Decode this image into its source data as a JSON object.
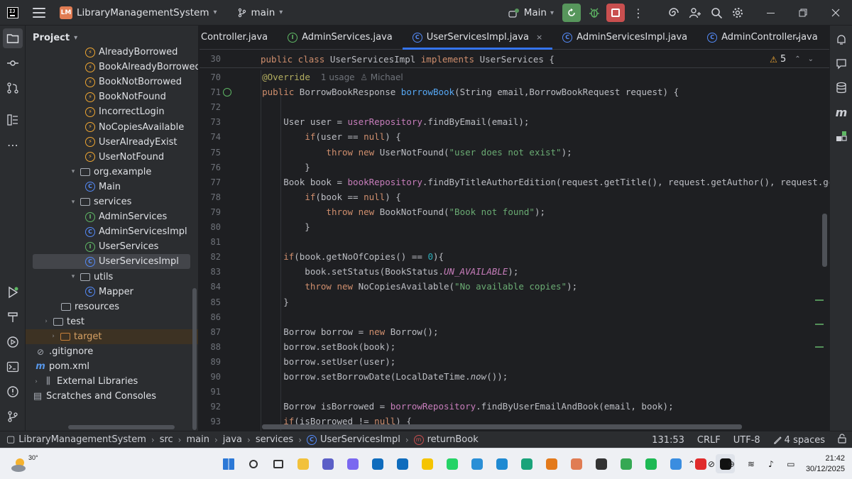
{
  "titlebar": {
    "app_badge": "LM",
    "project_name": "LibraryManagementSystem",
    "branch": "main",
    "run_config": "Main"
  },
  "project_panel": {
    "title": "Project",
    "items": [
      {
        "label": "AlreadyBorrowed",
        "kind": "exception"
      },
      {
        "label": "BookAlreadyBorrowed",
        "kind": "exception"
      },
      {
        "label": "BookNotBorrowed",
        "kind": "exception"
      },
      {
        "label": "BookNotFound",
        "kind": "exception"
      },
      {
        "label": "IncorrectLogin",
        "kind": "exception"
      },
      {
        "label": "NoCopiesAvailable",
        "kind": "exception"
      },
      {
        "label": "UserAlreadyExist",
        "kind": "exception"
      },
      {
        "label": "UserNotFound",
        "kind": "exception"
      },
      {
        "label": "org.example",
        "kind": "package"
      },
      {
        "label": "Main",
        "kind": "class-main"
      },
      {
        "label": "services",
        "kind": "package"
      },
      {
        "label": "AdminServices",
        "kind": "interface"
      },
      {
        "label": "AdminServicesImpl",
        "kind": "class"
      },
      {
        "label": "UserServices",
        "kind": "interface"
      },
      {
        "label": "UserServicesImpl",
        "kind": "class"
      },
      {
        "label": "utils",
        "kind": "package"
      },
      {
        "label": "Mapper",
        "kind": "class"
      },
      {
        "label": "resources",
        "kind": "folder"
      },
      {
        "label": "test",
        "kind": "folder"
      },
      {
        "label": "target",
        "kind": "folder-excluded"
      },
      {
        "label": ".gitignore",
        "kind": "file"
      },
      {
        "label": "pom.xml",
        "kind": "maven"
      },
      {
        "label": "External Libraries",
        "kind": "libraries"
      },
      {
        "label": "Scratches and Consoles",
        "kind": "scratches"
      }
    ]
  },
  "editor": {
    "tabs": [
      {
        "label": "Controller.java",
        "kind": "class"
      },
      {
        "label": "AdminServices.java",
        "kind": "interface"
      },
      {
        "label": "UserServicesImpl.java",
        "kind": "class"
      },
      {
        "label": "AdminServicesImpl.java",
        "kind": "class"
      },
      {
        "label": "AdminController.java",
        "kind": "class"
      }
    ],
    "active_tab_index": 2,
    "tab_close": "×",
    "sticky": {
      "line": "30",
      "text": ""
    },
    "warnings": "5",
    "hint_usage": "1 usage",
    "hint_author": "Michael",
    "line_numbers": [
      "70",
      "71",
      "72",
      "73",
      "74",
      "75",
      "76",
      "77",
      "78",
      "79",
      "80",
      "81",
      "82",
      "83",
      "84",
      "85",
      "86",
      "87",
      "88",
      "89",
      "90",
      "91",
      "92",
      "93"
    ],
    "strings": {
      "user_not_exist": "\"user does not exist\"",
      "book_not_found": "\"Book not found\"",
      "no_copies": "\"No available copies\""
    }
  },
  "statusbar": {
    "breadcrumbs": [
      "LibraryManagementSystem",
      "src",
      "main",
      "java",
      "services",
      "UserServicesImpl",
      "returnBook"
    ],
    "position": "131:53",
    "line_ending": "CRLF",
    "encoding": "UTF-8",
    "indent": "4 spaces"
  },
  "taskbar": {
    "temperature": "30°",
    "time": "21:42",
    "date": "30/12/2025"
  },
  "colors": {
    "accent": "#3574f0",
    "run": "#57965c",
    "stop": "#c94f4f",
    "keyword": "#cf8e6d",
    "method": "#56a8f5",
    "string": "#6aab73"
  }
}
